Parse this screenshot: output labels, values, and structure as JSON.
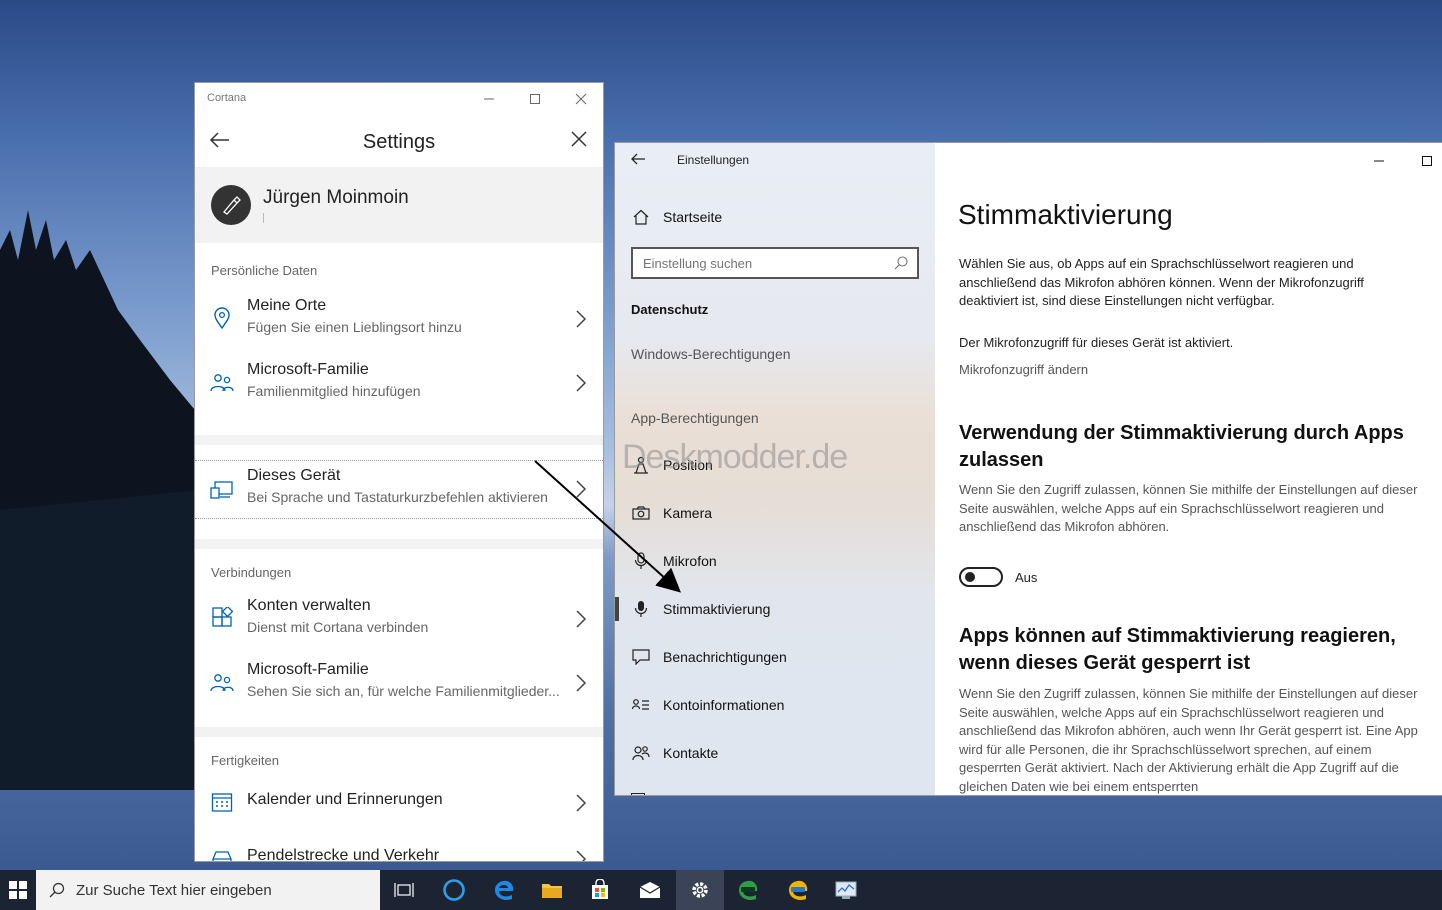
{
  "cortana": {
    "window_title": "Cortana",
    "header_title": "Settings",
    "profile_name": "Jürgen Moinmoin",
    "sections": [
      {
        "heading": "Persönliche Daten",
        "items": [
          {
            "title": "Meine Orte",
            "subtitle": "Fügen Sie einen Lieblingsort hinzu",
            "icon": "location-pin-icon"
          },
          {
            "title": "Microsoft-Familie",
            "subtitle": "Familienmitglied hinzufügen",
            "icon": "family-icon"
          }
        ]
      },
      {
        "heading": "",
        "items": [
          {
            "title": "Dieses Gerät",
            "subtitle": "Bei Sprache und Tastaturkurzbefehlen aktivieren",
            "icon": "device-icon"
          }
        ]
      },
      {
        "heading": "Verbindungen",
        "items": [
          {
            "title": "Konten verwalten",
            "subtitle": "Dienst mit Cortana verbinden",
            "icon": "connected-apps-icon"
          },
          {
            "title": "Microsoft-Familie",
            "subtitle": "Sehen Sie sich an, für welche Familienmitglieder...",
            "icon": "family-icon"
          }
        ]
      },
      {
        "heading": "Fertigkeiten",
        "items": [
          {
            "title": "Kalender und Erinnerungen",
            "subtitle": "",
            "icon": "calendar-icon"
          },
          {
            "title": "Pendelstrecke und Verkehr",
            "subtitle": "",
            "icon": "car-icon"
          }
        ]
      }
    ]
  },
  "settings": {
    "window_title": "Einstellungen",
    "home_label": "Startseite",
    "search_placeholder": "Einstellung suchen",
    "category": "Datenschutz",
    "windows_permissions": "Windows-Berechtigungen",
    "app_permissions": "App-Berechtigungen",
    "nav_items": [
      {
        "label": "Position",
        "icon": "location-person-icon"
      },
      {
        "label": "Kamera",
        "icon": "camera-icon"
      },
      {
        "label": "Mikrofon",
        "icon": "microphone-icon"
      },
      {
        "label": "Stimmaktivierung",
        "icon": "voice-activation-icon",
        "active": true
      },
      {
        "label": "Benachrichtigungen",
        "icon": "notification-icon"
      },
      {
        "label": "Kontoinformationen",
        "icon": "account-info-icon"
      },
      {
        "label": "Kontakte",
        "icon": "contacts-icon"
      }
    ],
    "page_title": "Stimmaktivierung",
    "intro": "Wählen Sie aus, ob Apps auf ein Sprachschlüsselwort reagieren und anschließend das Mikrofon abhören können. Wenn der Mikrofonzugriff deaktiviert ist, sind diese Einstellungen nicht verfügbar.",
    "mic_status": "Der Mikrofonzugriff für dieses Gerät ist aktiviert.",
    "mic_change_link": "Mikrofonzugriff ändern",
    "section1_title": "Verwendung der Stimmaktivierung durch Apps zulassen",
    "section1_desc": "Wenn Sie den Zugriff zulassen, können Sie mithilfe der Einstellungen auf dieser Seite auswählen, welche Apps auf ein Sprachschlüsselwort reagieren und anschließend das Mikrofon abhören.",
    "toggle_label": "Aus",
    "toggle_on": false,
    "section2_title": "Apps können auf Stimmaktivierung reagieren, wenn dieses Gerät gesperrt ist",
    "section2_desc": "Wenn Sie den Zugriff zulassen, können Sie mithilfe der Einstellungen auf dieser Seite auswählen, welche Apps auf ein Sprachschlüsselwort reagieren und anschließend das Mikrofon abhören, auch wenn Ihr Gerät gesperrt ist. Eine App wird für alle Personen, die ihr Sprachschlüsselwort sprechen, auf einem gesperrten Gerät aktiviert. Nach der Aktivierung erhält die App Zugriff auf die gleichen Daten wie bei einem entsperrten"
  },
  "watermark": "Deskmodder.de",
  "taskbar": {
    "search_placeholder": "Zur Suche Text hier eingeben",
    "icons": [
      "windows-start-icon",
      "task-view-icon",
      "cortana-icon",
      "edge-icon",
      "file-explorer-icon",
      "store-icon",
      "mail-icon",
      "settings-gear-icon",
      "edge-dev-icon",
      "edge-canary-icon",
      "system-monitor-icon"
    ]
  }
}
